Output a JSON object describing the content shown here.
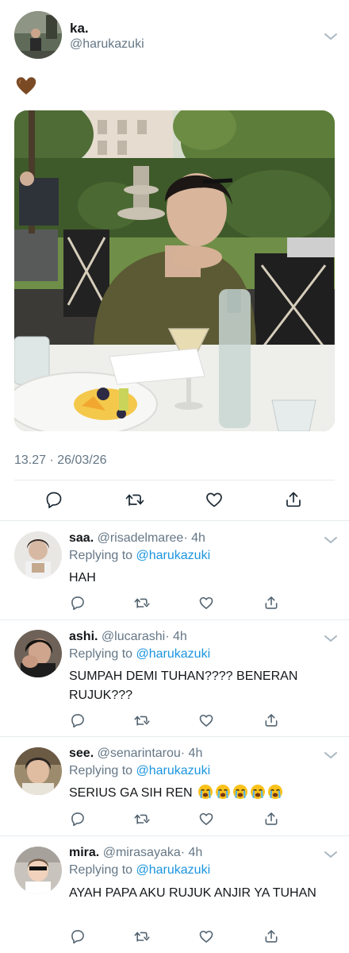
{
  "tweet": {
    "name": "ka.",
    "handle": "@harukazuki",
    "emoji": "brown-heart",
    "timestamp": "13.27 · 26/03/26",
    "actions": [
      "reply",
      "retweet",
      "like",
      "share"
    ]
  },
  "replies": [
    {
      "name": "saa.",
      "handle": "@risadelmaree",
      "age": "· 4h",
      "replying_prefix": "Replying to",
      "replying_to": "@harukazuki",
      "text": "HAH",
      "emoji_count": 0
    },
    {
      "name": "ashi.",
      "handle": "@lucarashi",
      "age": "· 4h",
      "replying_prefix": "Replying to",
      "replying_to": "@harukazuki",
      "text": "SUMPAH DEMI TUHAN???? BENERAN RUJUK???",
      "emoji_count": 0
    },
    {
      "name": "see.",
      "handle": "@senarintarou",
      "age": "· 4h",
      "replying_prefix": "Replying to",
      "replying_to": "@harukazuki",
      "text": "SERIUS GA SIH REN",
      "emoji": "loudly-crying-face",
      "emoji_count": 5
    },
    {
      "name": "mira.",
      "handle": "@mirasayaka",
      "age": "· 4h",
      "replying_prefix": "Replying to",
      "replying_to": "@harukazuki",
      "text": "AYAH PAPA AKU RUJUK ANJIR YA TUHAN",
      "emoji_count": 0
    }
  ],
  "colors": {
    "text": "#14171a",
    "secondary": "#657786",
    "link": "#1b95e0",
    "divider": "#e6ecf0"
  }
}
